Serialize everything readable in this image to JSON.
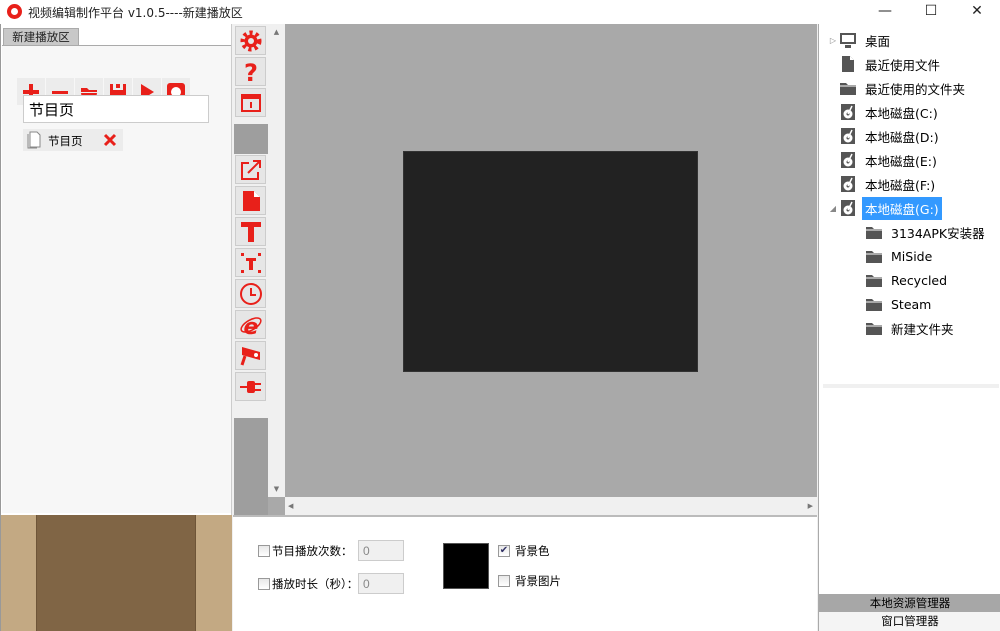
{
  "window": {
    "title": "视频编辑制作平台 v1.0.5----新建播放区",
    "minimize": "—",
    "maximize": "☐",
    "close": "✕"
  },
  "left": {
    "tab": "新建播放区",
    "program_name": "节目页",
    "page_item": "节目页"
  },
  "toolbar": [
    "add",
    "remove",
    "open",
    "save",
    "play",
    "stop"
  ],
  "vertical_toolbar": [
    "settings",
    "help",
    "window-info",
    "external-link",
    "file",
    "text",
    "text-frame",
    "clock",
    "browser",
    "camera",
    "plug"
  ],
  "properties": {
    "play_count_label": "节目播放次数：",
    "play_count_value": "0",
    "play_count_checked": false,
    "duration_label": "播放时长（秒）：",
    "duration_value": "0",
    "duration_checked": false,
    "bg_color_label": "背景色",
    "bg_color_checked": true,
    "bg_color": "#000000",
    "bg_image_label": "背景图片",
    "bg_image_checked": false
  },
  "tree": [
    {
      "label": "桌面",
      "icon": "monitor",
      "level": 0,
      "expander": "▷"
    },
    {
      "label": "最近使用文件",
      "icon": "file",
      "level": 0
    },
    {
      "label": "最近使用的文件夹",
      "icon": "folder",
      "level": 0
    },
    {
      "label": "本地磁盘(C:)",
      "icon": "disk",
      "level": 0
    },
    {
      "label": "本地磁盘(D:)",
      "icon": "disk",
      "level": 0
    },
    {
      "label": "本地磁盘(E:)",
      "icon": "disk",
      "level": 0
    },
    {
      "label": "本地磁盘(F:)",
      "icon": "disk",
      "level": 0
    },
    {
      "label": "本地磁盘(G:)",
      "icon": "disk",
      "level": 0,
      "expander": "◢",
      "selected": true
    },
    {
      "label": "3134APK安装器",
      "icon": "folder",
      "level": 1
    },
    {
      "label": "MiSide",
      "icon": "folder",
      "level": 1
    },
    {
      "label": "Recycled",
      "icon": "folder",
      "level": 1
    },
    {
      "label": "Steam",
      "icon": "folder",
      "level": 1
    },
    {
      "label": "新建文件夹",
      "icon": "folder",
      "level": 1
    }
  ],
  "right_tabs": {
    "local": "本地资源管理器",
    "window": "窗口管理器"
  },
  "colors": {
    "accent": "#e8201a",
    "selection": "#3399ff",
    "canvas": "#a9a9a9",
    "stage": "#222222"
  }
}
